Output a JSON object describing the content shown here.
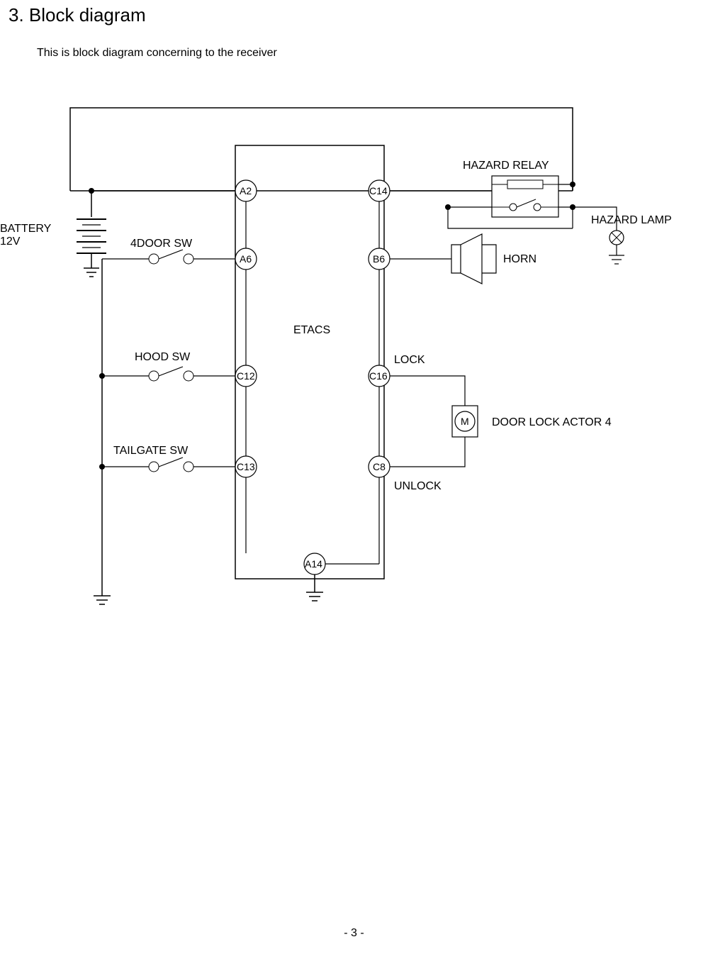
{
  "title": "3. Block diagram",
  "subtitle": "This is block diagram concerning to the receiver",
  "footer": "- 3 -",
  "labels": {
    "battery_top": "BATTERY",
    "battery_bottom": "12V",
    "four_door_sw": "4DOOR SW",
    "hood_sw": "HOOD SW",
    "tailgate_sw": "TAILGATE SW",
    "etacs": "ETACS",
    "hazard_relay": "HAZARD RELAY",
    "hazard_lamp": "HAZARD LAMP",
    "horn": "HORN",
    "lock": "LOCK",
    "unlock": "UNLOCK",
    "door_lock_actor": "DOOR LOCK ACTOR  4",
    "motor": "M"
  },
  "pins": {
    "a2": "A2",
    "a6": "A6",
    "c12": "C12",
    "c13": "C13",
    "a14": "A14",
    "c14": "C14",
    "b6": "B6",
    "c16": "C16",
    "c8": "C8"
  }
}
